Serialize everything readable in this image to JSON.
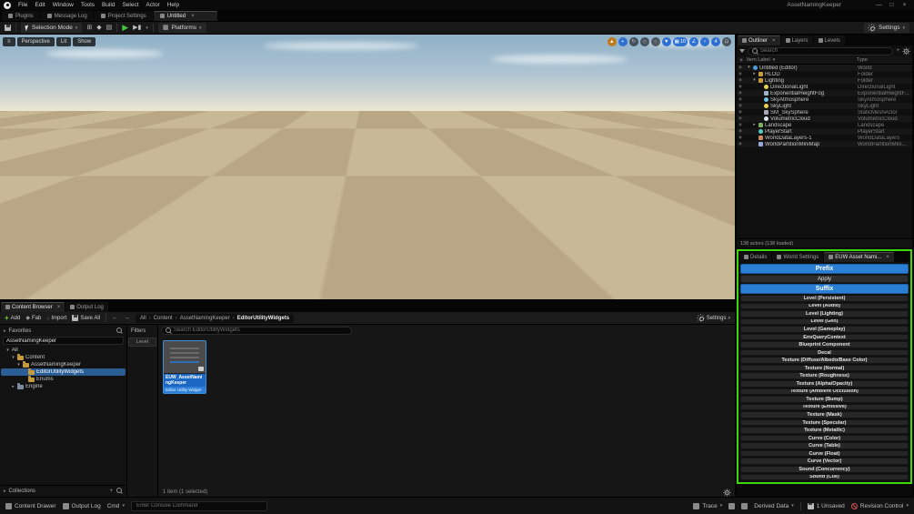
{
  "colors": {
    "accent_blue": "#2a7fd4",
    "highlight_green": "#3fd60b",
    "play_green": "#43c33f"
  },
  "titlebar": {
    "menus": [
      "File",
      "Edit",
      "Window",
      "Tools",
      "Build",
      "Select",
      "Actor",
      "Help"
    ],
    "title": "AssetNamingKeeper"
  },
  "doc_tabs": [
    {
      "label": "Plugins",
      "active": false
    },
    {
      "label": "Message Log",
      "active": false
    },
    {
      "label": "Project Settings",
      "active": false
    },
    {
      "label": "Untitled",
      "active": true
    }
  ],
  "toolbar": {
    "selection_mode": "Selection Mode",
    "platforms": "Platforms",
    "settings": "Settings"
  },
  "viewport": {
    "pills": [
      "Perspective",
      "Lit",
      "Show"
    ],
    "tools": [
      {
        "name": "select-tool",
        "style": "on-orange"
      },
      {
        "name": "move-tool",
        "style": "on-blue"
      },
      {
        "name": "rotate-tool"
      },
      {
        "name": "scale-tool"
      },
      {
        "name": "coordinate-space-toggle"
      },
      {
        "name": "surface-snap-toggle",
        "style": "on-blue"
      },
      {
        "name": "grid-snap-toggle",
        "value": "10",
        "style": "on-blue"
      },
      {
        "name": "rotation-snap-toggle",
        "style": "on-blue"
      },
      {
        "name": "scale-snap-toggle",
        "style": "on-blue"
      },
      {
        "name": "camera-speed",
        "value": "4",
        "style": "on-blue"
      },
      {
        "name": "maximize-viewport"
      }
    ]
  },
  "outliner": {
    "tabs": [
      "Outliner",
      "Layers",
      "Levels"
    ],
    "search_placeholder": "Search",
    "col_label": "Item Label",
    "col_type": "Type",
    "rows": [
      {
        "label": "Untitled (Editor)",
        "type": "World",
        "indent": 0,
        "icon": "world",
        "expand": "down"
      },
      {
        "label": "HLOD",
        "type": "Folder",
        "indent": 1,
        "icon": "folder",
        "expand": "right"
      },
      {
        "label": "Lighting",
        "type": "Folder",
        "indent": 1,
        "icon": "folder",
        "expand": "down"
      },
      {
        "label": "DirectionalLight",
        "type": "DirectionalLight",
        "indent": 2,
        "icon": "light"
      },
      {
        "label": "ExponentialHeightFog",
        "type": "ExponentialHeightF...",
        "indent": 2,
        "icon": "fog"
      },
      {
        "label": "SkyAtmosphere",
        "type": "SkyAtmosphere",
        "indent": 2,
        "icon": "sky"
      },
      {
        "label": "SkyLight",
        "type": "SkyLight",
        "indent": 2,
        "icon": "light"
      },
      {
        "label": "SM_SkySphere",
        "type": "StaticMeshActor",
        "indent": 2,
        "icon": "mesh"
      },
      {
        "label": "VolumetricCloud",
        "type": "VolumetricCloud",
        "indent": 2,
        "icon": "cloud"
      },
      {
        "label": "Landscape",
        "type": "Landscape",
        "indent": 1,
        "icon": "landscape",
        "expand": "right"
      },
      {
        "label": "PlayerStart",
        "type": "PlayerStart",
        "indent": 1,
        "icon": "player"
      },
      {
        "label": "WorldDataLayers-1",
        "type": "WorldDataLayers",
        "indent": 1,
        "icon": "layers"
      },
      {
        "label": "WorldPartitionMiniMap",
        "type": "WorldPartitionMini...",
        "indent": 1,
        "icon": "map"
      }
    ],
    "footer": "138 actors (138 loaded)"
  },
  "details_panel": {
    "tabs": [
      "Details",
      "World Settings",
      "EUW Asset Nami..."
    ],
    "naming": {
      "prefix": "Prefix",
      "apply": "Apply",
      "suffix": "Suffix",
      "buttons": [
        "Level (Persistent)",
        "Level (Audio)",
        "Level (Lighting)",
        "Level (Geo)",
        "Level (Gameplay)",
        "EnvQueryContext",
        "Blueprint Component",
        "Decal",
        "Texture (Diffuse/Albedo/Base Color)",
        "Texture (Normal)",
        "Texture (Roughness)",
        "Texture (Alpha/Opacity)",
        "Texture (Ambient Occlusion)",
        "Texture (Bump)",
        "Texture (Emissive)",
        "Texture (Mask)",
        "Texture (Specular)",
        "Texture (Metallic)",
        "Curve (Color)",
        "Curve (Table)",
        "Curve (Float)",
        "Curve (Vector)",
        "Sound (Concurrency)",
        "Sound (Cue)"
      ]
    }
  },
  "content_browser": {
    "tabs": [
      "Content Browser",
      "Output Log"
    ],
    "toolbar": {
      "add": "Add",
      "fab": "Fab",
      "import": "Import",
      "save_all": "Save All",
      "settings": "Settings"
    },
    "breadcrumb": [
      "All",
      "Content",
      "AssetNamingKeeper",
      "EditorUtilityWidgets"
    ],
    "favorites_label": "Favorites",
    "sources_search_value": "AssetNamingKeeper",
    "tree": [
      {
        "label": "All",
        "indent": 0,
        "expand": "down",
        "icon": null
      },
      {
        "label": "Content",
        "indent": 1,
        "expand": "down",
        "icon": "folder"
      },
      {
        "label": "AssetNamingKeeper",
        "indent": 2,
        "expand": "down",
        "icon": "folder"
      },
      {
        "label": "EditorUtilityWidgets",
        "indent": 3,
        "icon": "folder",
        "selected": true
      },
      {
        "label": "Enums",
        "indent": 3,
        "icon": "folder"
      },
      {
        "label": "Engine",
        "indent": 1,
        "expand": "right",
        "icon": "folder-gray"
      }
    ],
    "filters_label": "Filters",
    "filter_chip": "Level",
    "search_placeholder": "Search EditorUtilityWidgets",
    "asset": {
      "name": "EUW_AssetNamingKeeper",
      "type_label": "Editor Utility Widget"
    },
    "status": "1 item (1 selected)",
    "collections_label": "Collections"
  },
  "status_bar": {
    "content_drawer": "Content Drawer",
    "output_log": "Output Log",
    "cmd": "Cmd",
    "console_placeholder": "Enter Console Command",
    "trace": "Trace",
    "derived_data": "Derived Data",
    "unsaved": "1 Unsaved",
    "revision_control": "Revision Control"
  }
}
